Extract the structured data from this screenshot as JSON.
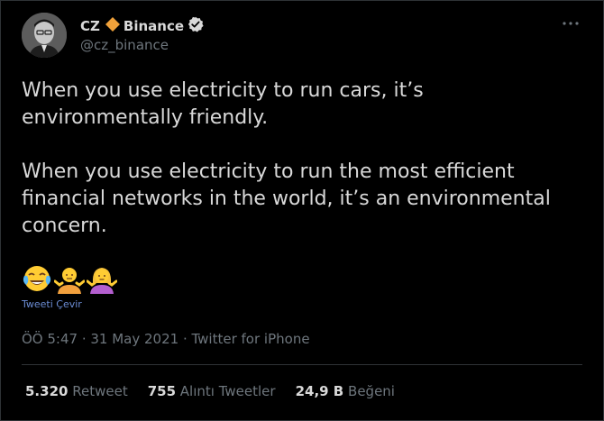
{
  "author": {
    "display_name": "CZ",
    "display_name_suffix": "Binance",
    "handle": "@cz_binance",
    "avatar": "avatar-photo",
    "diamond_icon": "orange-diamond-icon",
    "verified_icon": "verified-badge-icon"
  },
  "tweet": {
    "paragraphs": [
      "When you use electricity to run cars, it’s environmentally friendly.",
      "When you use electricity to run the most efficient financial networks in the world, it’s an environmental concern."
    ],
    "emojis": [
      "face-with-tears-of-joy",
      "person-shrugging",
      "woman-shrugging"
    ],
    "translate_label": "Tweeti Çevir"
  },
  "meta": {
    "timestamp": "ÖÖ 5:47 · 31 May 2021 · Twitter for iPhone"
  },
  "stats": {
    "retweets_count": "5.320",
    "retweets_label": "Retweet",
    "quotes_count": "755",
    "quotes_label": "Alıntı Tweetler",
    "likes_count": "24,9 B",
    "likes_label": "Beğeni"
  },
  "colors": {
    "background": "#000000",
    "text": "#d9d9d9",
    "secondary": "#6e767d",
    "link": "#6b8cd4",
    "divider": "#2f3336",
    "diamond": "#f0a13a"
  }
}
